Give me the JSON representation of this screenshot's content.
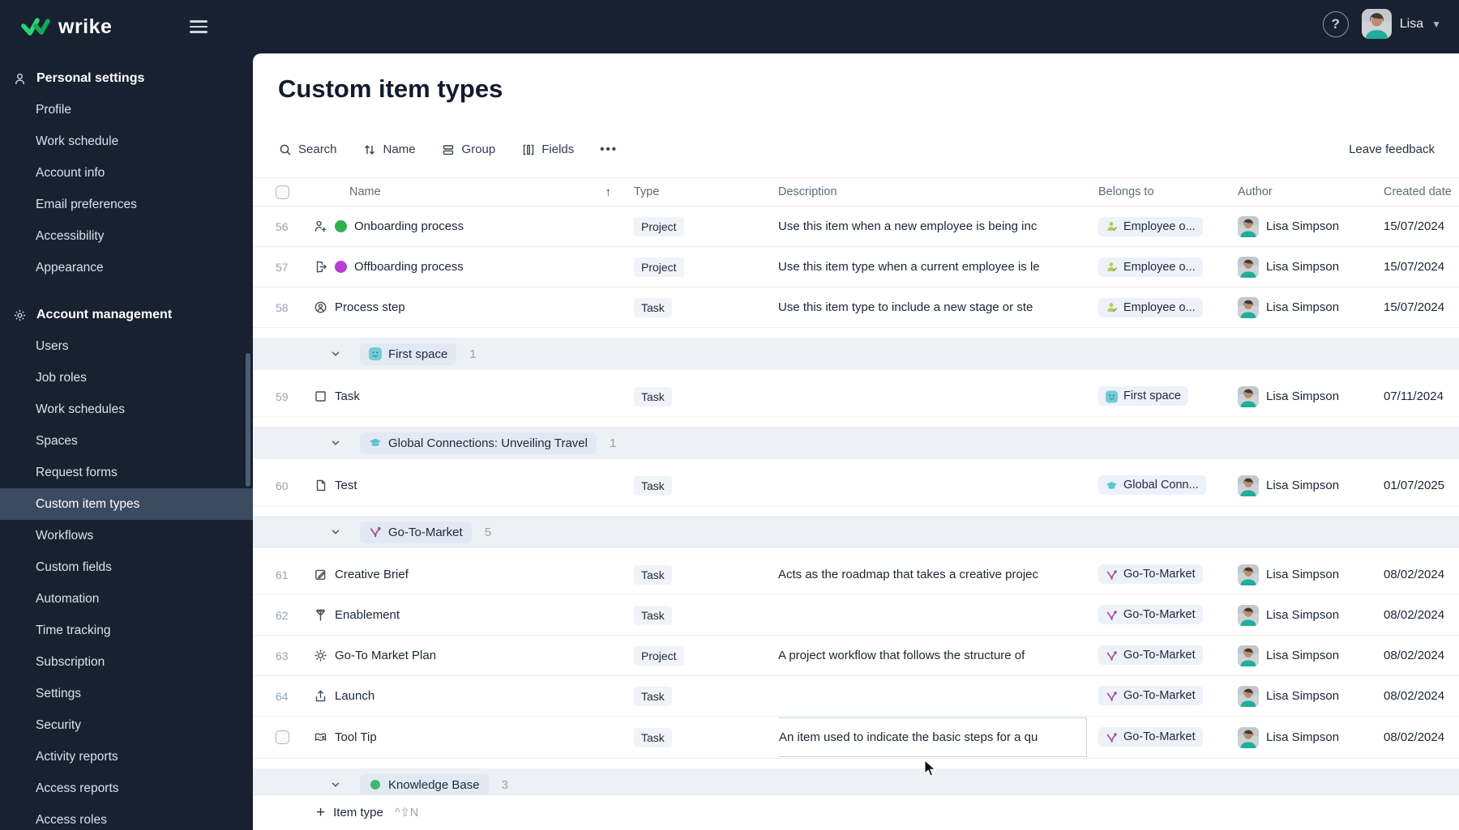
{
  "topbar": {
    "logo_text": "wrike",
    "user_name": "Lisa",
    "help_label": "?"
  },
  "sidebar": {
    "sections": [
      {
        "label": "Personal settings",
        "icon": "person-icon",
        "items": [
          {
            "label": "Profile",
            "selected": false
          },
          {
            "label": "Work schedule",
            "selected": false
          },
          {
            "label": "Account info",
            "selected": false
          },
          {
            "label": "Email preferences",
            "selected": false
          },
          {
            "label": "Accessibility",
            "selected": false
          },
          {
            "label": "Appearance",
            "selected": false
          }
        ]
      },
      {
        "label": "Account management",
        "icon": "gear-icon",
        "items": [
          {
            "label": "Users",
            "selected": false
          },
          {
            "label": "Job roles",
            "selected": false
          },
          {
            "label": "Work schedules",
            "selected": false
          },
          {
            "label": "Spaces",
            "selected": false
          },
          {
            "label": "Request forms",
            "selected": false
          },
          {
            "label": "Custom item types",
            "selected": true
          },
          {
            "label": "Workflows",
            "selected": false
          },
          {
            "label": "Custom fields",
            "selected": false
          },
          {
            "label": "Automation",
            "selected": false
          },
          {
            "label": "Time tracking",
            "selected": false
          },
          {
            "label": "Subscription",
            "selected": false
          },
          {
            "label": "Settings",
            "selected": false
          },
          {
            "label": "Security",
            "selected": false
          },
          {
            "label": "Activity reports",
            "selected": false
          },
          {
            "label": "Access reports",
            "selected": false
          },
          {
            "label": "Access roles",
            "selected": false
          }
        ]
      }
    ]
  },
  "main": {
    "title": "Custom item types",
    "toolbar": {
      "search_label": "Search",
      "sort_label": "Name",
      "group_label": "Group",
      "fields_label": "Fields",
      "more_label": "•••",
      "leave_feedback": "Leave feedback"
    },
    "table": {
      "headers": {
        "name": "Name",
        "type": "Type",
        "description": "Description",
        "belongs_to": "Belongs to",
        "author": "Author",
        "created_date": "Created date"
      },
      "rows": [
        {
          "kind": "item",
          "num": "56",
          "icon": "person-add-icon",
          "chip": "#2bb14a",
          "name": "Onboarding process",
          "type": "Project",
          "desc": "Use this item when a new employee is being inc",
          "belongs_icon": "employee-icon",
          "belongs": "Employee o...",
          "author": "Lisa Simpson",
          "date": "15/07/2024"
        },
        {
          "kind": "item",
          "num": "57",
          "icon": "exit-icon",
          "chip": "#b93dd4",
          "name": "Offboarding process",
          "type": "Project",
          "desc": "Use this item type when a current employee is le",
          "belongs_icon": "employee-icon",
          "belongs": "Employee o...",
          "author": "Lisa Simpson",
          "date": "15/07/2024"
        },
        {
          "kind": "item",
          "num": "58",
          "icon": "person-circle-icon",
          "chip": "",
          "name": "Process step",
          "type": "Task",
          "desc": "Use this item type to include a new stage or ste",
          "belongs_icon": "employee-icon",
          "belongs": "Employee o...",
          "author": "Lisa Simpson",
          "date": "15/07/2024"
        },
        {
          "kind": "group",
          "icon": "space-icon",
          "label": "First space",
          "count": "1"
        },
        {
          "kind": "item",
          "num": "59",
          "icon": "square-icon",
          "chip": "",
          "name": "Task",
          "type": "Task",
          "desc": "",
          "belongs_icon": "space-icon",
          "belongs": "First space",
          "author": "Lisa Simpson",
          "date": "07/11/2024"
        },
        {
          "kind": "group",
          "icon": "cap-icon",
          "label": "Global Connections: Unveiling Travel",
          "count": "1"
        },
        {
          "kind": "item",
          "num": "60",
          "icon": "document-icon",
          "chip": "",
          "name": "Test",
          "type": "Task",
          "desc": "",
          "belongs_icon": "cap-icon",
          "belongs": "Global Conn...",
          "author": "Lisa Simpson",
          "date": "01/07/2025"
        },
        {
          "kind": "group",
          "icon": "branch-icon",
          "label": "Go-To-Market",
          "count": "5"
        },
        {
          "kind": "item",
          "num": "61",
          "icon": "compose-icon",
          "chip": "",
          "name": "Creative Brief",
          "type": "Task",
          "desc": "Acts as the roadmap that takes a creative projec",
          "belongs_icon": "branch-icon",
          "belongs": "Go-To-Market",
          "author": "Lisa Simpson",
          "date": "08/02/2024"
        },
        {
          "kind": "item",
          "num": "62",
          "icon": "flow-icon",
          "chip": "",
          "name": "Enablement",
          "type": "Task",
          "desc": "",
          "belongs_icon": "branch-icon",
          "belongs": "Go-To-Market",
          "author": "Lisa Simpson",
          "date": "08/02/2024"
        },
        {
          "kind": "item",
          "num": "63",
          "icon": "sun-icon",
          "chip": "",
          "name": "Go-To Market Plan",
          "type": "Project",
          "desc": "A project workflow that follows the structure of",
          "belongs_icon": "branch-icon",
          "belongs": "Go-To-Market",
          "author": "Lisa Simpson",
          "date": "08/02/2024"
        },
        {
          "kind": "item",
          "num": "64",
          "icon": "launch-icon",
          "chip": "",
          "name": "Launch",
          "type": "Task",
          "desc": "",
          "belongs_icon": "branch-icon",
          "belongs": "Go-To-Market",
          "author": "Lisa Simpson",
          "date": "08/02/2024"
        },
        {
          "kind": "item",
          "num": "",
          "checkbox": true,
          "editing": true,
          "icon": "map-icon",
          "chip": "",
          "name": "Tool Tip",
          "type": "Task",
          "desc": "An item used to indicate the basic steps for a qu",
          "belongs_icon": "branch-icon",
          "belongs": "Go-To-Market",
          "author": "Lisa Simpson",
          "date": "08/02/2024"
        },
        {
          "kind": "group",
          "icon": "kb-icon",
          "label": "Knowledge Base",
          "count": "3",
          "partial": true
        }
      ]
    },
    "footer": {
      "add_label": "Item type",
      "shortcut": "^⇧N"
    }
  }
}
